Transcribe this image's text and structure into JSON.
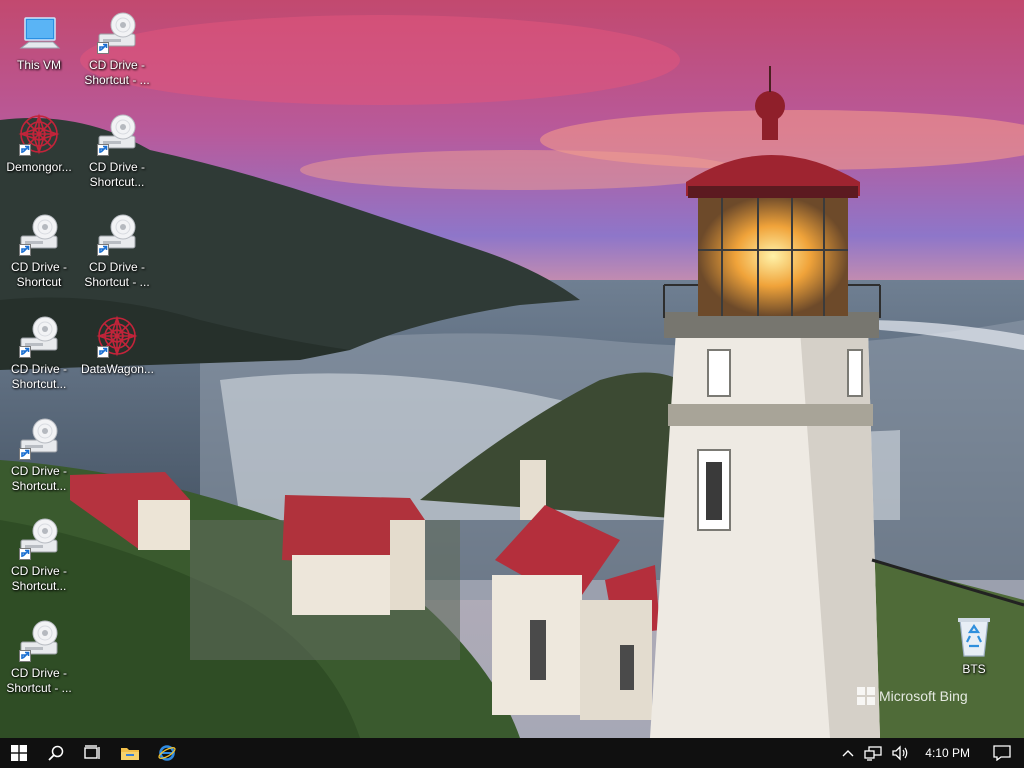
{
  "desktop": {
    "icons": [
      {
        "label": "This VM",
        "type": "computer"
      },
      {
        "label": "CD Drive -\nShortcut - ...",
        "type": "cd"
      },
      {
        "label": "Demongor...",
        "type": "spiral"
      },
      {
        "label": "CD Drive -\nShortcut...",
        "type": "cd"
      },
      {
        "label": "CD Drive -\nShortcut",
        "type": "cd"
      },
      {
        "label": "CD Drive -\nShortcut - ...",
        "type": "cd"
      },
      {
        "label": "CD Drive -\nShortcut...",
        "type": "cd"
      },
      {
        "label": "DataWagon...",
        "type": "spiral"
      },
      {
        "label": "CD Drive -\nShortcut...",
        "type": "cd"
      },
      {
        "label": "CD Drive -\nShortcut...",
        "type": "cd"
      },
      {
        "label": "CD Drive -\nShortcut - ...",
        "type": "cd"
      },
      {
        "label": "BTS",
        "type": "recycle-bin"
      }
    ],
    "watermark": "Microsoft Bing"
  },
  "taskbar": {
    "clock": "4:10 PM",
    "accent": "#101010"
  }
}
